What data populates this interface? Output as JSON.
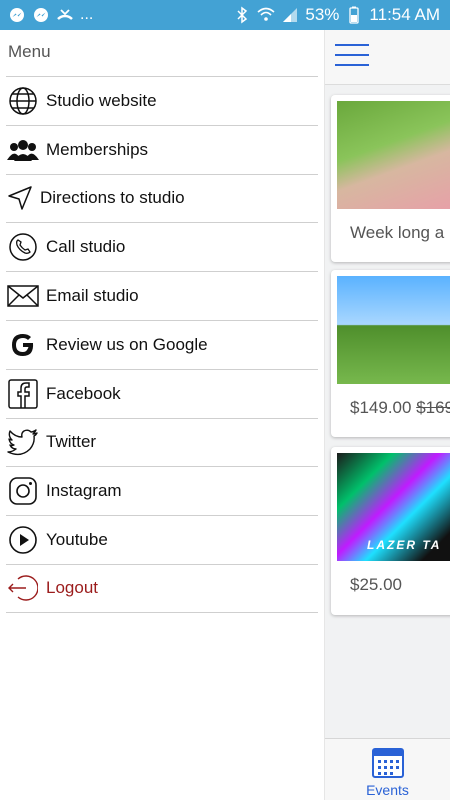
{
  "status_bar": {
    "left_icons": [
      "messenger-icon",
      "messenger-icon",
      "missed-call-icon"
    ],
    "overflow": "...",
    "battery": "53%",
    "time": "11:54 AM",
    "bg_color": "#43a2d4"
  },
  "drawer": {
    "title": "Menu",
    "items": [
      {
        "label": "Studio website",
        "icon": "globe-icon"
      },
      {
        "label": "Memberships",
        "icon": "people-icon"
      },
      {
        "label": "Directions to studio",
        "icon": "navigation-arrow-icon"
      },
      {
        "label": "Call studio",
        "icon": "phone-icon"
      },
      {
        "label": "Email studio",
        "icon": "envelope-icon"
      },
      {
        "label": "Review us on Google",
        "icon": "google-icon"
      },
      {
        "label": "Facebook",
        "icon": "facebook-icon"
      },
      {
        "label": "Twitter",
        "icon": "twitter-icon"
      },
      {
        "label": "Instagram",
        "icon": "instagram-icon"
      },
      {
        "label": "Youtube",
        "icon": "youtube-play-icon"
      },
      {
        "label": "Logout",
        "icon": "logout-icon"
      }
    ],
    "logout_color": "#9b1c1c"
  },
  "app": {
    "cards": [
      {
        "text": "Week long a"
      },
      {
        "price": "$149.00",
        "old_price": "$169"
      },
      {
        "price": "$25.00",
        "image_text": "LAZER TA"
      }
    ],
    "bottom_nav": {
      "label": "Events",
      "icon": "calendar-icon"
    },
    "accent": "#2a62d6"
  }
}
